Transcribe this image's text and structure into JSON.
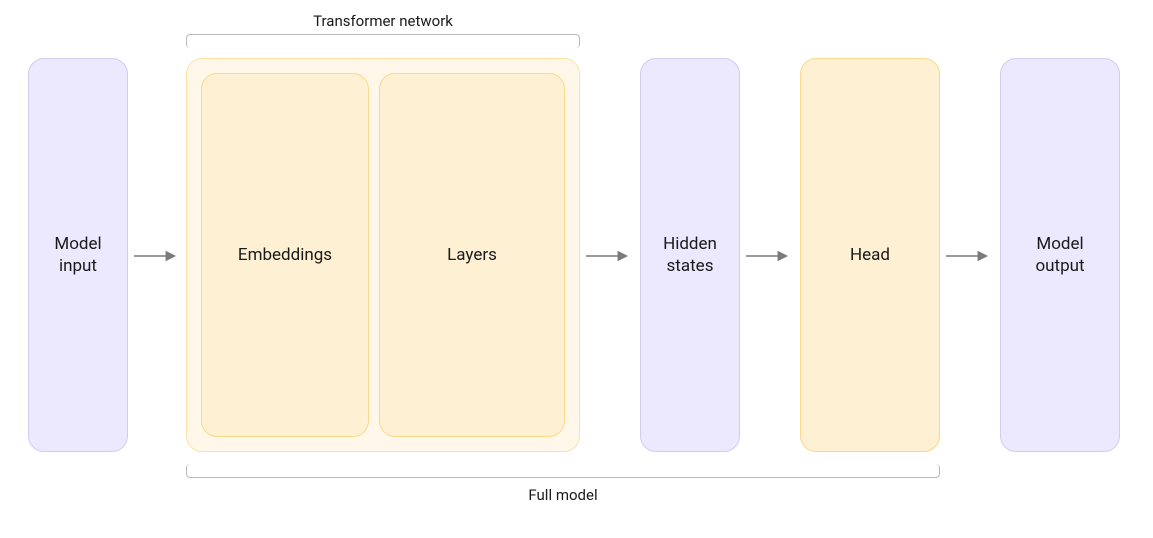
{
  "labels": {
    "transformer_network": "Transformer network",
    "full_model": "Full model"
  },
  "boxes": {
    "model_input": "Model input",
    "embeddings": "Embeddings",
    "layers": "Layers",
    "hidden_states": "Hidden states",
    "head": "Head",
    "model_output": "Model output"
  },
  "colors": {
    "purple_bg": "#ece8fd",
    "purple_border": "#d3ccf0",
    "orange_outer_bg": "#fff7e9",
    "orange_outer_border": "#fbe1a8",
    "orange_inner_bg": "#fdf0d3",
    "orange_inner_border": "#f9d98b",
    "arrow": "#7a7a7a",
    "bracket": "#b8b8b8"
  }
}
